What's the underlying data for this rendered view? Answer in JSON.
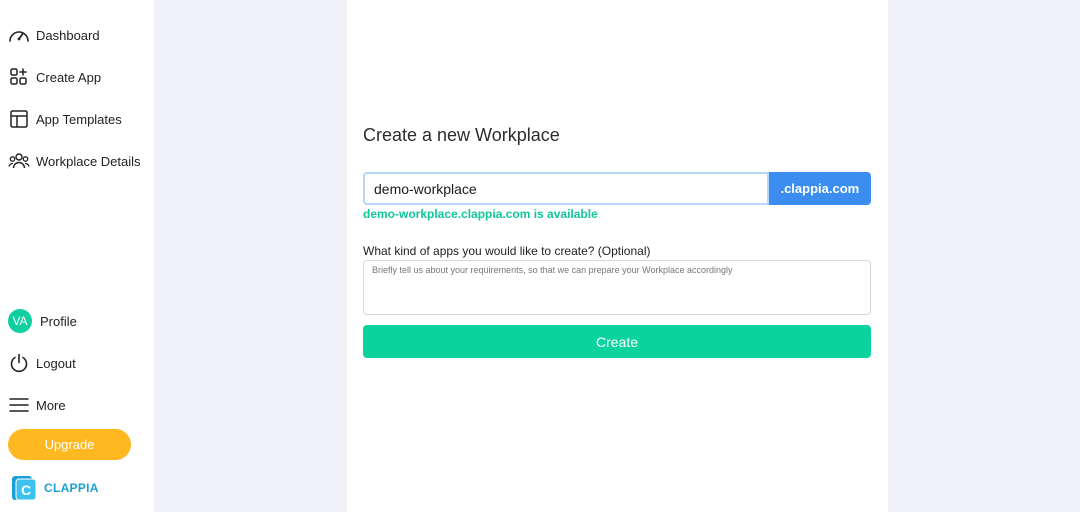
{
  "sidebar": {
    "items": [
      {
        "label": "Dashboard",
        "icon": "speedometer-icon"
      },
      {
        "label": "Create App",
        "icon": "grid-plus-icon"
      },
      {
        "label": "App Templates",
        "icon": "layout-template-icon"
      },
      {
        "label": "Workplace Details",
        "icon": "users-group-icon"
      }
    ],
    "bottom": {
      "profile": {
        "label": "Profile",
        "initials": "VA"
      },
      "logout": {
        "label": "Logout",
        "icon": "power-icon"
      },
      "more": {
        "label": "More",
        "icon": "hamburger-menu-icon"
      },
      "upgrade_label": "Upgrade"
    },
    "logo_text": "CLAPPIA"
  },
  "main": {
    "title": "Create a new Workplace",
    "domain_input_value": "demo-workplace",
    "domain_suffix": ".clappia.com",
    "availability_text": "demo-workplace.clappia.com is available",
    "question_label": "What kind of apps you would like to create? (Optional)",
    "requirements_placeholder": "Briefly tell us about your requirements, so that we can prepare your Workplace accordingly",
    "create_label": "Create"
  },
  "colors": {
    "accent_green": "#0ad39d",
    "accent_blue": "#3b8ef0",
    "upgrade_orange": "#ffb820",
    "available_text": "#11c79a",
    "background": "#f1f2f8"
  }
}
